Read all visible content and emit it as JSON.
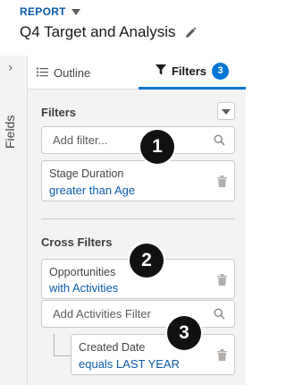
{
  "header": {
    "report_label": "REPORT",
    "title": "Q4 Target and Analysis"
  },
  "fields_rail": {
    "label": "Fields",
    "chevron": "›"
  },
  "tabs": [
    {
      "label": "Outline",
      "icon": "list-icon",
      "active": false
    },
    {
      "label": "Filters",
      "icon": "funnel-icon",
      "active": true,
      "badge": "3"
    }
  ],
  "filters_section": {
    "title": "Filters",
    "search_placeholder": "Add filter...",
    "items": [
      {
        "label": "Stage Duration",
        "value": "greater than Age"
      }
    ]
  },
  "cross_filters_section": {
    "title": "Cross Filters",
    "items": [
      {
        "label": "Opportunities",
        "value": "with Activities"
      }
    ],
    "search_placeholder": "Add Activities Filter",
    "sub_filters": [
      {
        "label": "Created Date",
        "value": "equals LAST YEAR"
      }
    ]
  },
  "callouts": [
    "1",
    "2",
    "3"
  ],
  "colors": {
    "accent": "#0176d3",
    "link": "#0b5cab",
    "panel_bg": "#f3f3f3",
    "callout_bg": "#111111"
  }
}
